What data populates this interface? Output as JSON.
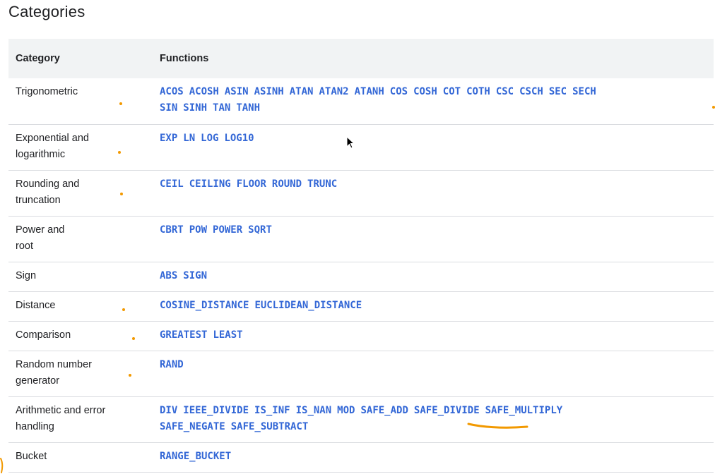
{
  "page_title": "Categories",
  "table": {
    "headers": {
      "category": "Category",
      "functions": "Functions"
    },
    "rows": [
      {
        "category": [
          "Trigonometric"
        ],
        "functions": [
          [
            "ACOS",
            "ACOSH",
            "ASIN",
            "ASINH",
            "ATAN",
            "ATAN2",
            "ATANH",
            "COS",
            "COSH",
            "COT",
            "COTH",
            "CSC",
            "CSCH",
            "SEC",
            "SECH"
          ],
          [
            "SIN",
            "SINH",
            "TAN",
            "TANH"
          ]
        ]
      },
      {
        "category": [
          "Exponential and",
          "logarithmic"
        ],
        "functions": [
          [
            "EXP",
            "LN",
            "LOG",
            "LOG10"
          ]
        ]
      },
      {
        "category": [
          "Rounding and",
          "truncation"
        ],
        "functions": [
          [
            "CEIL",
            "CEILING",
            "FLOOR",
            "ROUND",
            "TRUNC"
          ]
        ]
      },
      {
        "category": [
          "Power and",
          "root"
        ],
        "functions": [
          [
            "CBRT",
            "POW",
            "POWER",
            "SQRT"
          ]
        ]
      },
      {
        "category": [
          "Sign"
        ],
        "functions": [
          [
            "ABS",
            "SIGN"
          ]
        ]
      },
      {
        "category": [
          "Distance"
        ],
        "functions": [
          [
            "COSINE_DISTANCE",
            "EUCLIDEAN_DISTANCE"
          ]
        ]
      },
      {
        "category": [
          "Comparison"
        ],
        "functions": [
          [
            "GREATEST",
            "LEAST"
          ]
        ]
      },
      {
        "category": [
          "Random number",
          "generator"
        ],
        "functions": [
          [
            "RAND"
          ]
        ]
      },
      {
        "category": [
          "Arithmetic and error",
          "handling"
        ],
        "functions": [
          [
            "DIV",
            "IEEE_DIVIDE",
            "IS_INF",
            "IS_NAN",
            "MOD",
            "SAFE_ADD",
            "SAFE_DIVIDE",
            "SAFE_MULTIPLY"
          ],
          [
            "SAFE_NEGATE",
            "SAFE_SUBTRACT"
          ]
        ]
      },
      {
        "category": [
          "Bucket"
        ],
        "functions": [
          [
            "RANGE_BUCKET"
          ]
        ]
      }
    ]
  },
  "colors": {
    "link": "#3367d6",
    "header_bg": "#f1f3f4",
    "annotation": "#f29900"
  },
  "icons": [
    "mouse-cursor-icon"
  ]
}
